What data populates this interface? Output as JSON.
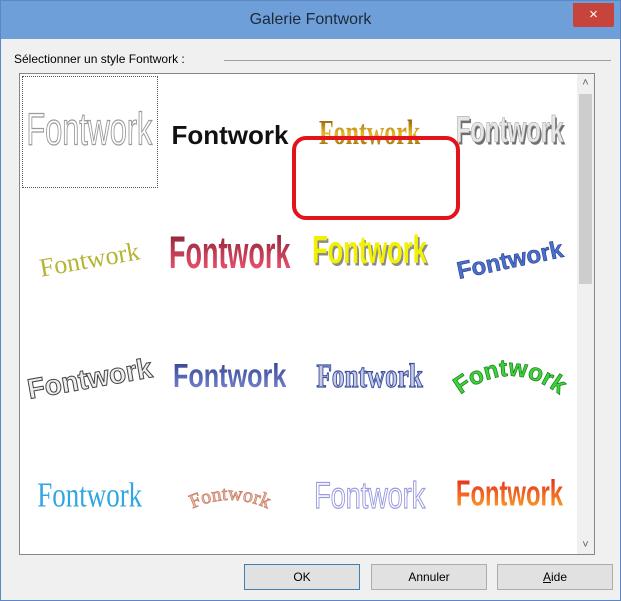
{
  "window": {
    "title": "Galerie Fontwork",
    "close_glyph": "×"
  },
  "group": {
    "label": "Sélectionner un style Fontwork :"
  },
  "gallery": {
    "items": [
      {
        "text": "Fontwork",
        "style": "outline-white"
      },
      {
        "text": "Fontwork",
        "style": "black-wave"
      },
      {
        "text": "Fontwork",
        "style": "gold-gradient"
      },
      {
        "text": "Fontwork",
        "style": "grey-3d"
      },
      {
        "text": "Fontwork",
        "style": "olive-slant"
      },
      {
        "text": "Fontwork",
        "style": "red-perspective"
      },
      {
        "text": "Fontwork",
        "style": "yellow-3d"
      },
      {
        "text": "Fontwork",
        "style": "blue-rise"
      },
      {
        "text": "Fontwork",
        "style": "grey-twist"
      },
      {
        "text": "Fontwork",
        "style": "navy-bold"
      },
      {
        "text": "Fontwork",
        "style": "navy-wave"
      },
      {
        "text": "Fontwork",
        "style": "green-arc"
      },
      {
        "text": "Fontwork",
        "style": "cyan-plain"
      },
      {
        "text": "Fontwork",
        "style": "brown-arc"
      },
      {
        "text": "Fontwork",
        "style": "lavender-outline"
      },
      {
        "text": "Fontwork",
        "style": "orange-red-bold"
      }
    ],
    "colors": {
      "highlight": "#e3121b",
      "gold": "#c99a1a",
      "olive": "#b5b437",
      "red": "#e23a52",
      "yellow": "#e8e800",
      "blue": "#4a6fd0",
      "navy": "#3a4f9e",
      "green": "#3bd43b",
      "cyan": "#30a7e0",
      "brown": "#c8836b",
      "lavender": "#b7b7ee",
      "orange": "#f26b21"
    }
  },
  "buttons": {
    "ok": "OK",
    "cancel": "Annuler",
    "help_first": "A",
    "help_rest": "ide"
  }
}
